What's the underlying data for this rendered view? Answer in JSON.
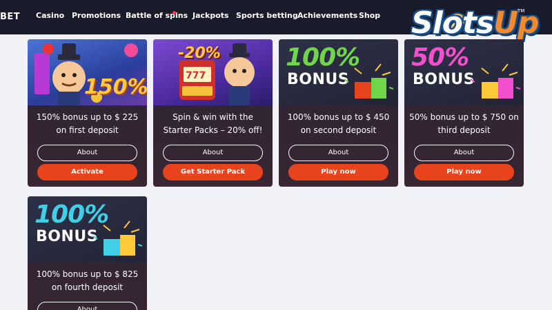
{
  "nav": {
    "brand": "BET",
    "items": [
      {
        "label": "Casino"
      },
      {
        "label": "Promotions"
      },
      {
        "label": "Battle of spins"
      },
      {
        "label": "Jackpots"
      },
      {
        "label": "Sports betting"
      },
      {
        "label": "Achievements"
      },
      {
        "label": "Shop"
      }
    ]
  },
  "watermark": {
    "text_main": "Slots",
    "text_accent": "Up",
    "tm": "TM"
  },
  "cards": [
    {
      "image_text": "150%",
      "title": "150% bonus up to $ 225 on first deposit",
      "about_label": "About",
      "action_label": "Activate"
    },
    {
      "image_text": "-20%",
      "title": "Spin & win with the Starter Packs – 20% off!",
      "about_label": "About",
      "action_label": "Get Starter Pack"
    },
    {
      "image_text": "100%",
      "image_word": "BONUS",
      "title": "100% bonus up to $ 450 on second deposit",
      "about_label": "About",
      "action_label": "Play now"
    },
    {
      "image_text": "50%",
      "image_word": "BONUS",
      "title": "50% bonus up to $ 750 on third deposit",
      "about_label": "About",
      "action_label": "Play now"
    },
    {
      "image_text": "100%",
      "image_word": "BONUS",
      "title": "100% bonus up to $ 825 on fourth deposit",
      "about_label": "About",
      "action_label": ""
    }
  ],
  "colors": {
    "nav_bg": "#191b2b",
    "page_bg": "#f1f2f7",
    "card_bg": "#2b2436",
    "accent_orange": "#e8431c",
    "green_pct": "#6fd64a",
    "pink_pct": "#f24fcf",
    "cyan_pct": "#3fd0e8",
    "gold_pct": "#ffc93a"
  }
}
